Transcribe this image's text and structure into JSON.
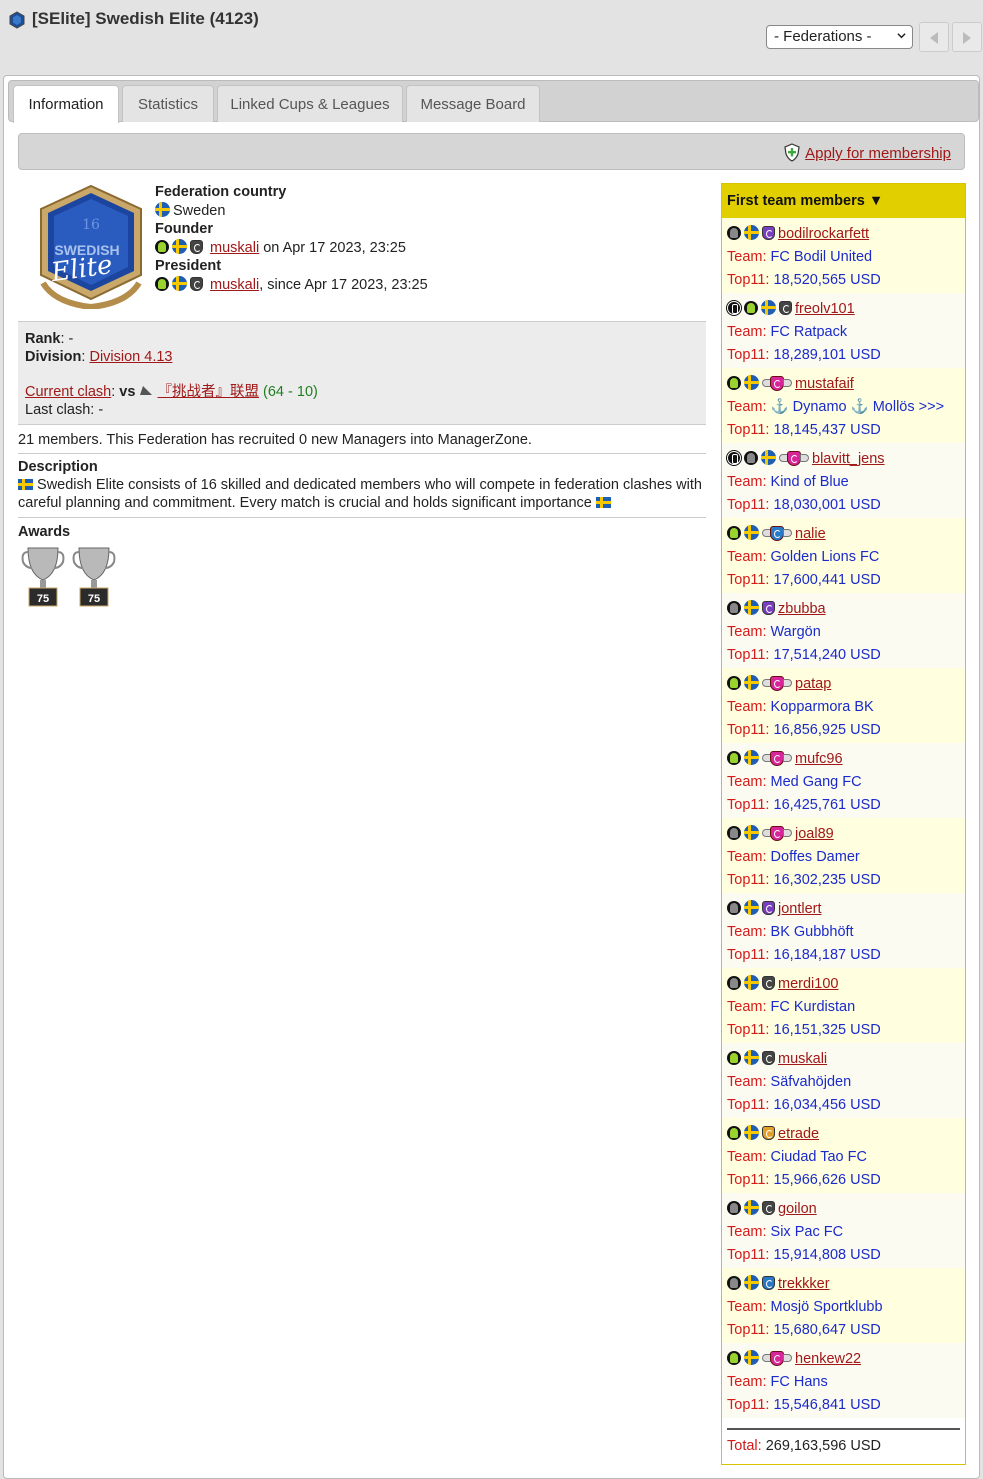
{
  "header": {
    "title": "[SElite] Swedish Elite (4123)",
    "federations_select": "- Federations -"
  },
  "tabs": [
    {
      "label": "Information"
    },
    {
      "label": "Statistics"
    },
    {
      "label": "Linked Cups & Leagues"
    },
    {
      "label": "Message Board"
    }
  ],
  "apply_link": "Apply for membership",
  "federation": {
    "country_label": "Federation country",
    "country": "Sweden",
    "founder_label": "Founder",
    "founder_name": "muskali",
    "founder_date": " on Apr 17 2023, 23:25",
    "president_label": "President",
    "president_name": "muskali",
    "president_date": ", since Apr 17 2023, 23:25",
    "crest_text_top": "16",
    "crest_text_mid": "SWEDISH",
    "crest_text_bottom": "Elite"
  },
  "rank": {
    "rank_label": "Rank",
    "rank_value": ": -",
    "division_label": "Division",
    "division_value": "Division 4.13",
    "current_clash_label": "Current clash",
    "vs": "vs",
    "opponent": "『挑战者』联盟",
    "score": "(64 - 10)",
    "last_clash": "Last clash: -"
  },
  "members_text": "21 members. This Federation has recruited 0 new Managers into ManagerZone.",
  "description": {
    "label": "Description",
    "text": "Swedish Elite consists of 16 skilled and dedicated members who will compete in federation clashes with careful planning and commitment. Every match is crucial and holds significant importance"
  },
  "awards": {
    "label": "Awards",
    "trophies": [
      "75",
      "75"
    ]
  },
  "sidebar": {
    "title": "First team members ▼",
    "team_label": "Team:",
    "top11_label": "Top11:",
    "members": [
      {
        "name": "bodilrockarfett",
        "team": "FC Bodil United",
        "top11": "18,520,565 USD",
        "user": "grey",
        "acc": false,
        "badge": "purple"
      },
      {
        "name": "freolv101",
        "team": "FC Ratpack",
        "top11": "18,289,101 USD",
        "user": "green",
        "acc": true,
        "badge": "dark"
      },
      {
        "name": "mustafaif",
        "team": "⚓ Dynamo ⚓ Mollös >>>",
        "top11": "18,145,437 USD",
        "user": "green",
        "acc": false,
        "badge": "wing"
      },
      {
        "name": "blavitt_jens",
        "team": "Kind of Blue",
        "top11": "18,030,001 USD",
        "user": "grey",
        "acc": true,
        "badge": "wing"
      },
      {
        "name": "nalie",
        "team": "Golden Lions FC",
        "top11": "17,600,441 USD",
        "user": "green",
        "acc": false,
        "badge": "wingblue"
      },
      {
        "name": "zbubba",
        "team": "Wargön",
        "top11": "17,514,240 USD",
        "user": "grey",
        "acc": false,
        "badge": "purple"
      },
      {
        "name": "patap",
        "team": "Kopparmora BK",
        "top11": "16,856,925 USD",
        "user": "green",
        "acc": false,
        "badge": "wing"
      },
      {
        "name": "mufc96",
        "team": "Med Gang FC",
        "top11": "16,425,761 USD",
        "user": "green",
        "acc": false,
        "badge": "wing"
      },
      {
        "name": "joal89",
        "team": "Doffes Damer",
        "top11": "16,302,235 USD",
        "user": "grey",
        "acc": false,
        "badge": "wing"
      },
      {
        "name": "jontlert",
        "team": "BK Gubbhöft",
        "top11": "16,184,187 USD",
        "user": "grey",
        "acc": false,
        "badge": "purple"
      },
      {
        "name": "merdi100",
        "team": "FC Kurdistan",
        "top11": "16,151,325 USD",
        "user": "grey",
        "acc": false,
        "badge": "dark"
      },
      {
        "name": "muskali",
        "team": "Säfvahöjden",
        "top11": "16,034,456 USD",
        "user": "green",
        "acc": false,
        "badge": "dark"
      },
      {
        "name": "etrade",
        "team": "Ciudad Tao FC",
        "top11": "15,966,626 USD",
        "user": "green",
        "acc": false,
        "badge": "orange"
      },
      {
        "name": "goilon",
        "team": "Six Pac FC",
        "top11": "15,914,808 USD",
        "user": "grey",
        "acc": false,
        "badge": "dark"
      },
      {
        "name": "trekkker",
        "team": "Mosjö Sportklubb",
        "top11": "15,680,647 USD",
        "user": "grey",
        "acc": false,
        "badge": "blue"
      },
      {
        "name": "henkew22",
        "team": "FC Hans",
        "top11": "15,546,841 USD",
        "user": "green",
        "acc": false,
        "badge": "wing"
      }
    ],
    "total_label": "Total:",
    "total_value": "269,163,596 USD"
  },
  "colors": {
    "link": "#a01818",
    "label_red": "#d41a1a",
    "value_blue": "#1a2acb",
    "sidebar_header": "#e2cf00",
    "sidebar_row": "#ffffe0"
  }
}
